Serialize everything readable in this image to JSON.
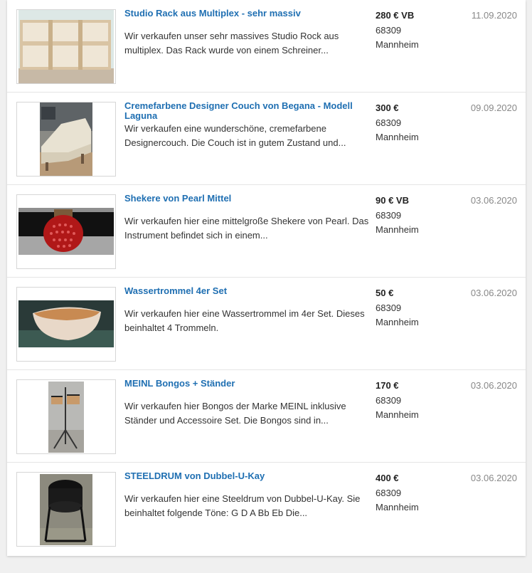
{
  "listings": [
    {
      "title": "Studio Rack aus Multiplex - sehr massiv",
      "description": "Wir verkaufen unser sehr massives Studio Rock aus multiplex. Das Rack wurde von einem Schreiner...",
      "price": "280 € VB",
      "zip": "68309",
      "city": "Mannheim",
      "date": "11.09.2020",
      "image": "studio-rack"
    },
    {
      "title": "Cremefarbene Designer Couch von Begana - Modell Laguna",
      "description": "Wir verkaufen eine wunderschöne, cremefarbene Designercouch. Die Couch ist in gutem Zustand und...",
      "price": "300 €",
      "zip": "68309",
      "city": "Mannheim",
      "date": "09.09.2020",
      "image": "couch"
    },
    {
      "title": "Shekere von Pearl Mittel",
      "description": "Wir verkaufen hier eine mittelgroße Shekere von Pearl. Das Instrument befindet sich in einem...",
      "price": "90 € VB",
      "zip": "68309",
      "city": "Mannheim",
      "date": "03.06.2020",
      "image": "shekere"
    },
    {
      "title": "Wassertrommel 4er Set",
      "description": "Wir verkaufen hier eine Wassertrommel im 4er Set. Dieses beinhaltet 4 Trommeln.",
      "price": "50 €",
      "zip": "68309",
      "city": "Mannheim",
      "date": "03.06.2020",
      "image": "water-drum"
    },
    {
      "title": "MEINL Bongos + Ständer",
      "description": "Wir verkaufen hier Bongos der Marke MEINL inklusive Ständer und Accessoire Set. Die Bongos sind in...",
      "price": "170 €",
      "zip": "68309",
      "city": "Mannheim",
      "date": "03.06.2020",
      "image": "bongos"
    },
    {
      "title": "STEELDRUM von Dubbel-U-Kay",
      "description": "Wir verkaufen hier eine Steeldrum von Dubbel-U-Kay. Sie beinhaltet folgende Töne: G D A Bb Eb Die...",
      "price": "400 €",
      "zip": "68309",
      "city": "Mannheim",
      "date": "03.06.2020",
      "image": "steeldrum"
    }
  ],
  "colors": {
    "title_link": "#1f6fb2",
    "date": "#888888",
    "background": "#f0f0f0"
  }
}
